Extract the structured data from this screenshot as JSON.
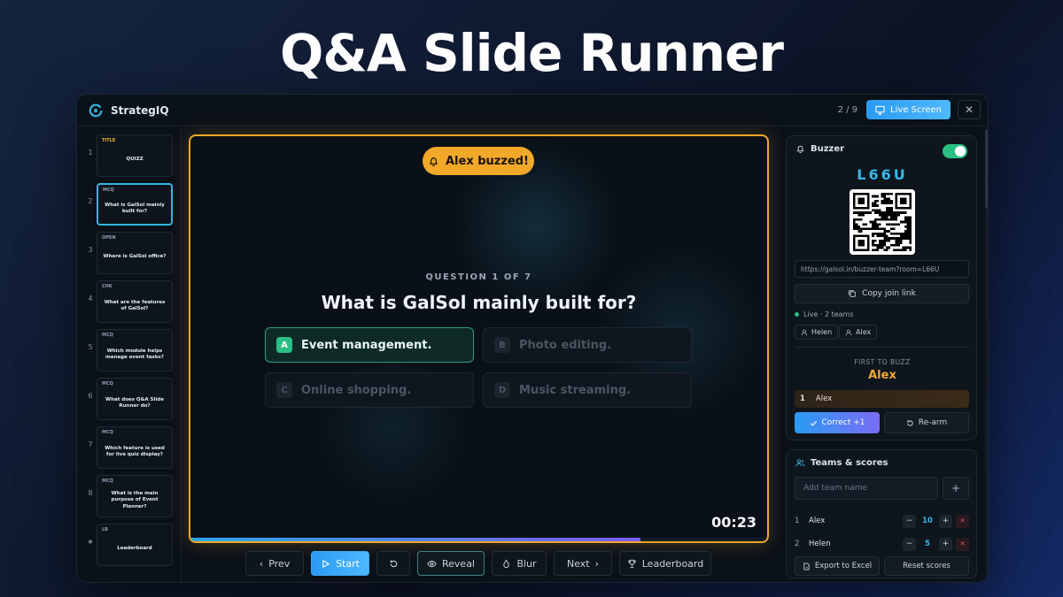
{
  "hero": {
    "title": "Q&A Slide Runner"
  },
  "app": {
    "brand": "StrategIQ"
  },
  "topbar": {
    "slide_count": "2 / 9",
    "live_screen_label": "Live Screen",
    "close_symbol": "✕"
  },
  "slides": [
    {
      "num": "1",
      "tag": "TITLE",
      "text": "QUIZZ"
    },
    {
      "num": "2",
      "tag": "MCQ",
      "text": "What is GalSol mainly built for?"
    },
    {
      "num": "3",
      "tag": "OPEN",
      "text": "Where is GalSol office?"
    },
    {
      "num": "4",
      "tag": "CHK",
      "text": "What are the features of GalSol?"
    },
    {
      "num": "5",
      "tag": "MCQ",
      "text": "Which module helps manage event tasks?"
    },
    {
      "num": "6",
      "tag": "MCQ",
      "text": "What does Q&A Slide Runner do?"
    },
    {
      "num": "7",
      "tag": "MCQ",
      "text": "Which feature is used for live quiz display?"
    },
    {
      "num": "8",
      "tag": "MCQ",
      "text": "What is the main purpose of Event Planner?"
    },
    {
      "num": "★",
      "tag": "LB",
      "text": "Leaderboard"
    }
  ],
  "stage": {
    "buzz_banner": "Alex buzzed!",
    "question_label": "QUESTION 1 OF 7",
    "question": "What is GalSol mainly built for?",
    "options": [
      {
        "letter": "A",
        "text": "Event management.",
        "correct": true
      },
      {
        "letter": "B",
        "text": "Photo editing.",
        "correct": false
      },
      {
        "letter": "C",
        "text": "Online shopping.",
        "correct": false
      },
      {
        "letter": "D",
        "text": "Music streaming.",
        "correct": false
      }
    ],
    "timer": "00:23",
    "progress_fraction": 0.78
  },
  "controls": {
    "prev": "Prev",
    "start": "Start",
    "reveal": "Reveal",
    "blur": "Blur",
    "next": "Next",
    "leaderboard": "Leaderboard",
    "chevron_left": "‹",
    "chevron_right": "›"
  },
  "buzzer": {
    "title": "Buzzer",
    "enabled": true,
    "room_code": "L66U",
    "join_url": "https://galsol.in/buzzer-team?room=L66U",
    "copy_label": "Copy join link",
    "live_status": "Live · 2 teams",
    "teams": [
      "Helen",
      "Alex"
    ],
    "first_label": "FIRST TO BUZZ",
    "first_name": "Alex",
    "queue": [
      {
        "num": "1",
        "name": "Alex"
      }
    ],
    "correct_label": "Correct +1",
    "rearm_label": "Re-arm"
  },
  "scores": {
    "title": "Teams & scores",
    "add_placeholder": "Add team name",
    "add_symbol": "+",
    "minus_symbol": "−",
    "plus_symbol": "+",
    "delete_symbol": "✕",
    "rows": [
      {
        "num": "1",
        "name": "Alex",
        "score": "10"
      },
      {
        "num": "2",
        "name": "Helen",
        "score": "5"
      }
    ],
    "export_label": "Export to Excel",
    "reset_label": "Reset scores"
  },
  "colors": {
    "accent": "#35b7e0",
    "buzz": "#f2a92a",
    "correct": "#2bbf83"
  }
}
